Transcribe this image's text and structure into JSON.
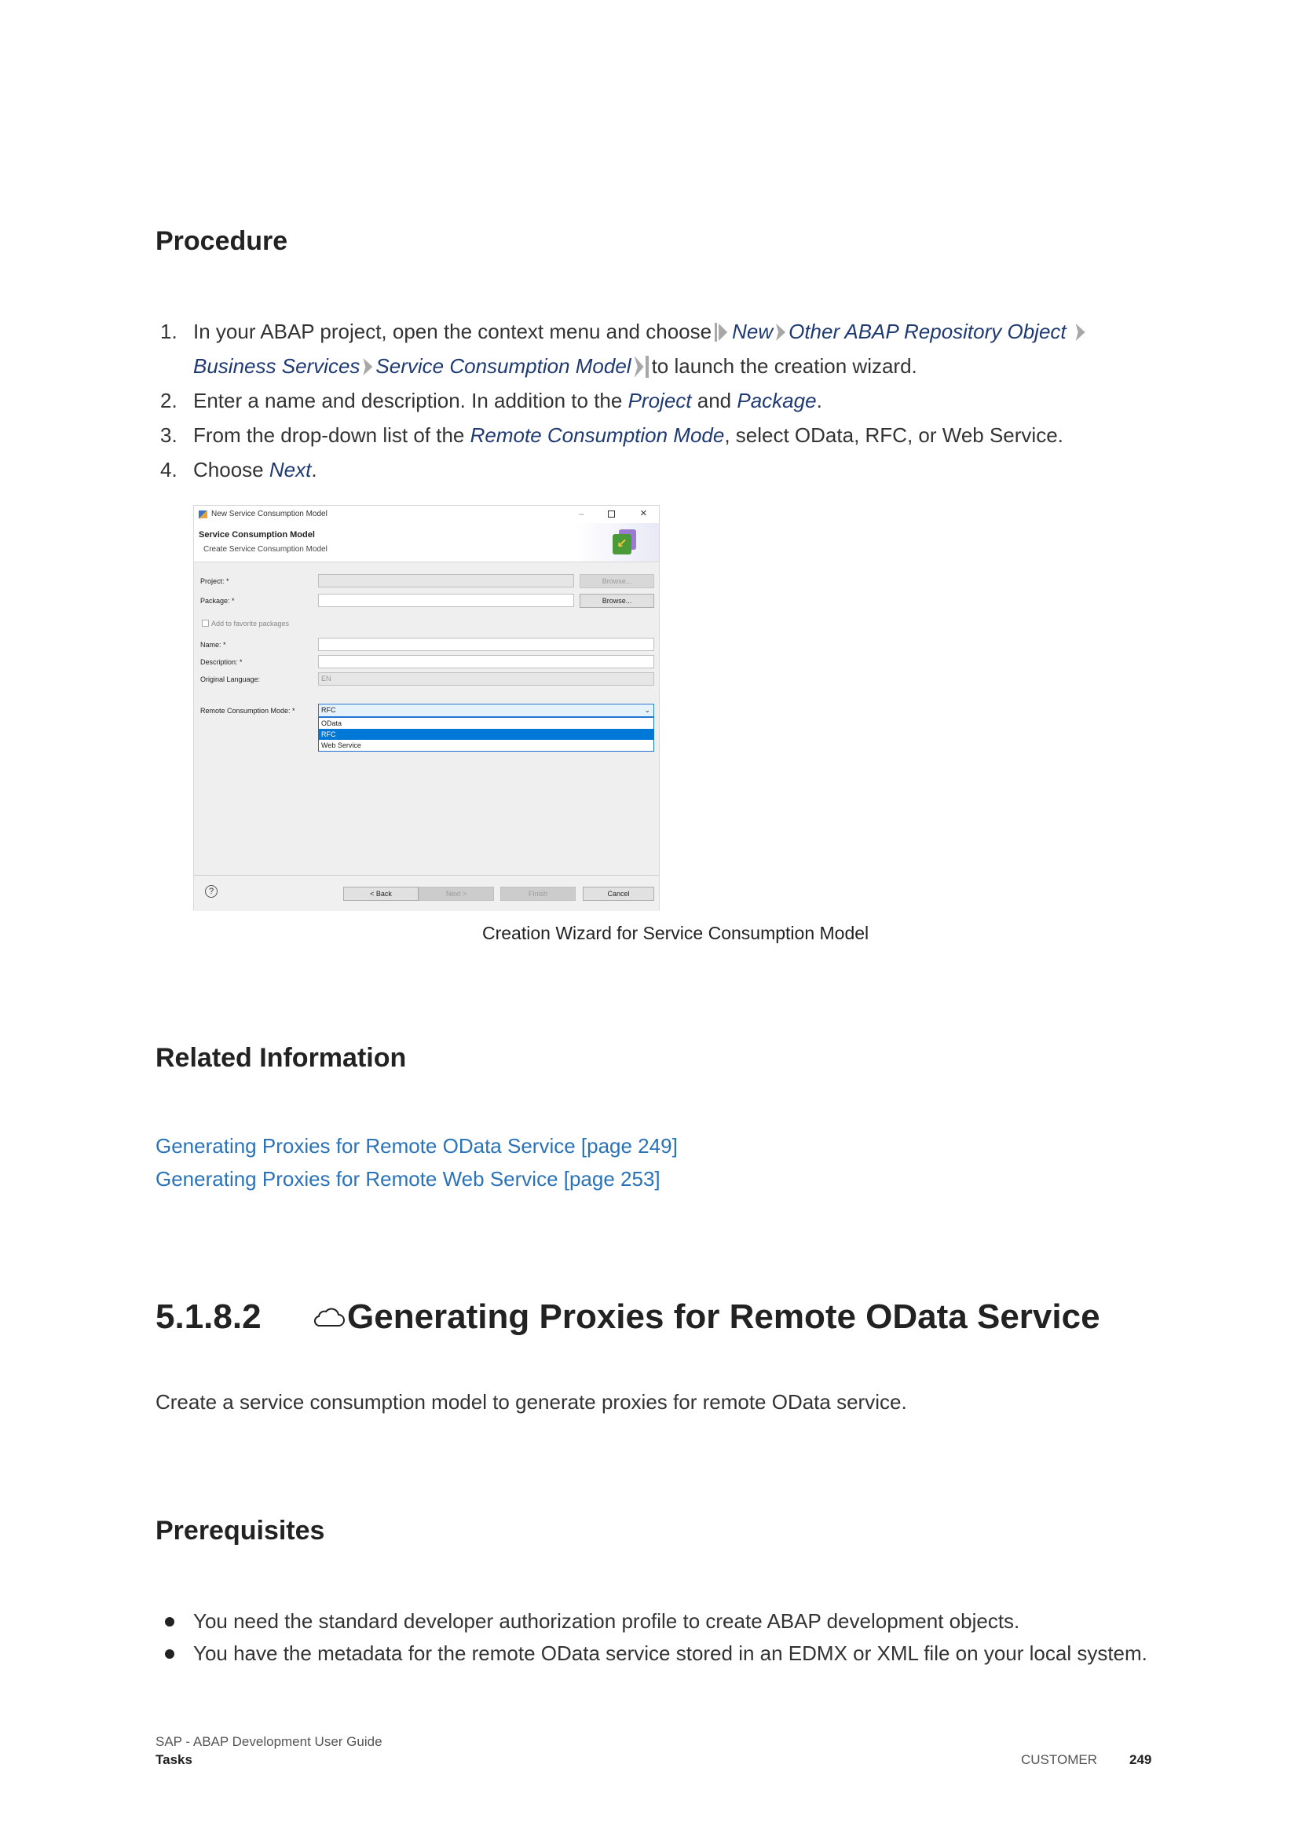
{
  "procedure": {
    "heading": "Procedure",
    "steps": [
      {
        "num": "1.",
        "text_a": "In your ABAP project, open the context menu and choose",
        "menu_new": "New",
        "menu_other": "Other ABAP Repository Object",
        "menu_business": "Business Services",
        "menu_scm": "Service Consumption Model",
        "text_b": "to launch the creation wizard."
      },
      {
        "num": "2.",
        "text_a": "Enter a name and description. In addition to the",
        "project": "Project",
        "and": "and",
        "package": "Package",
        "end": "."
      },
      {
        "num": "3.",
        "text_a": "From the drop-down list of the",
        "mode": "Remote Consumption Mode",
        "text_b": ", select OData, RFC, or Web Service."
      },
      {
        "num": "4.",
        "text_a": "Choose",
        "next": "Next",
        "end": "."
      }
    ]
  },
  "dialog": {
    "window_title": "New Service Consumption Model",
    "header_title": "Service Consumption Model",
    "header_subtitle": "Create Service Consumption Model",
    "project_label": "Project: *",
    "package_label": "Package: *",
    "browse_label": "Browse...",
    "favorite_label": "Add to favorite packages",
    "name_label": "Name: *",
    "description_label": "Description: *",
    "language_label": "Original Language:",
    "language_value": "EN",
    "mode_label": "Remote Consumption Mode: *",
    "mode_value": "RFC",
    "options": [
      "OData",
      "RFC",
      "Web Service"
    ],
    "help": "?",
    "back": "< Back",
    "next": "Next >",
    "finish": "Finish",
    "cancel": "Cancel"
  },
  "caption": "Creation Wizard for Service Consumption Model",
  "related": {
    "heading": "Related Information",
    "links": [
      "Generating Proxies for Remote OData Service [page 249]",
      "Generating Proxies for Remote Web Service [page 253]"
    ]
  },
  "section": {
    "number": "5.1.8.2",
    "title": "Generating Proxies for Remote OData Service",
    "icon": "cloud-icon",
    "intro": "Create a service consumption model to generate proxies for remote OData service."
  },
  "prerequisites": {
    "heading": "Prerequisites",
    "items": [
      "You need the standard developer authorization profile to create ABAP development objects.",
      "You have the metadata for the remote OData service stored in an EDMX or XML file on your local system."
    ]
  },
  "footer": {
    "doc_title": "SAP - ABAP Development User Guide",
    "section": "Tasks",
    "audience": "CUSTOMER",
    "page": "249"
  }
}
